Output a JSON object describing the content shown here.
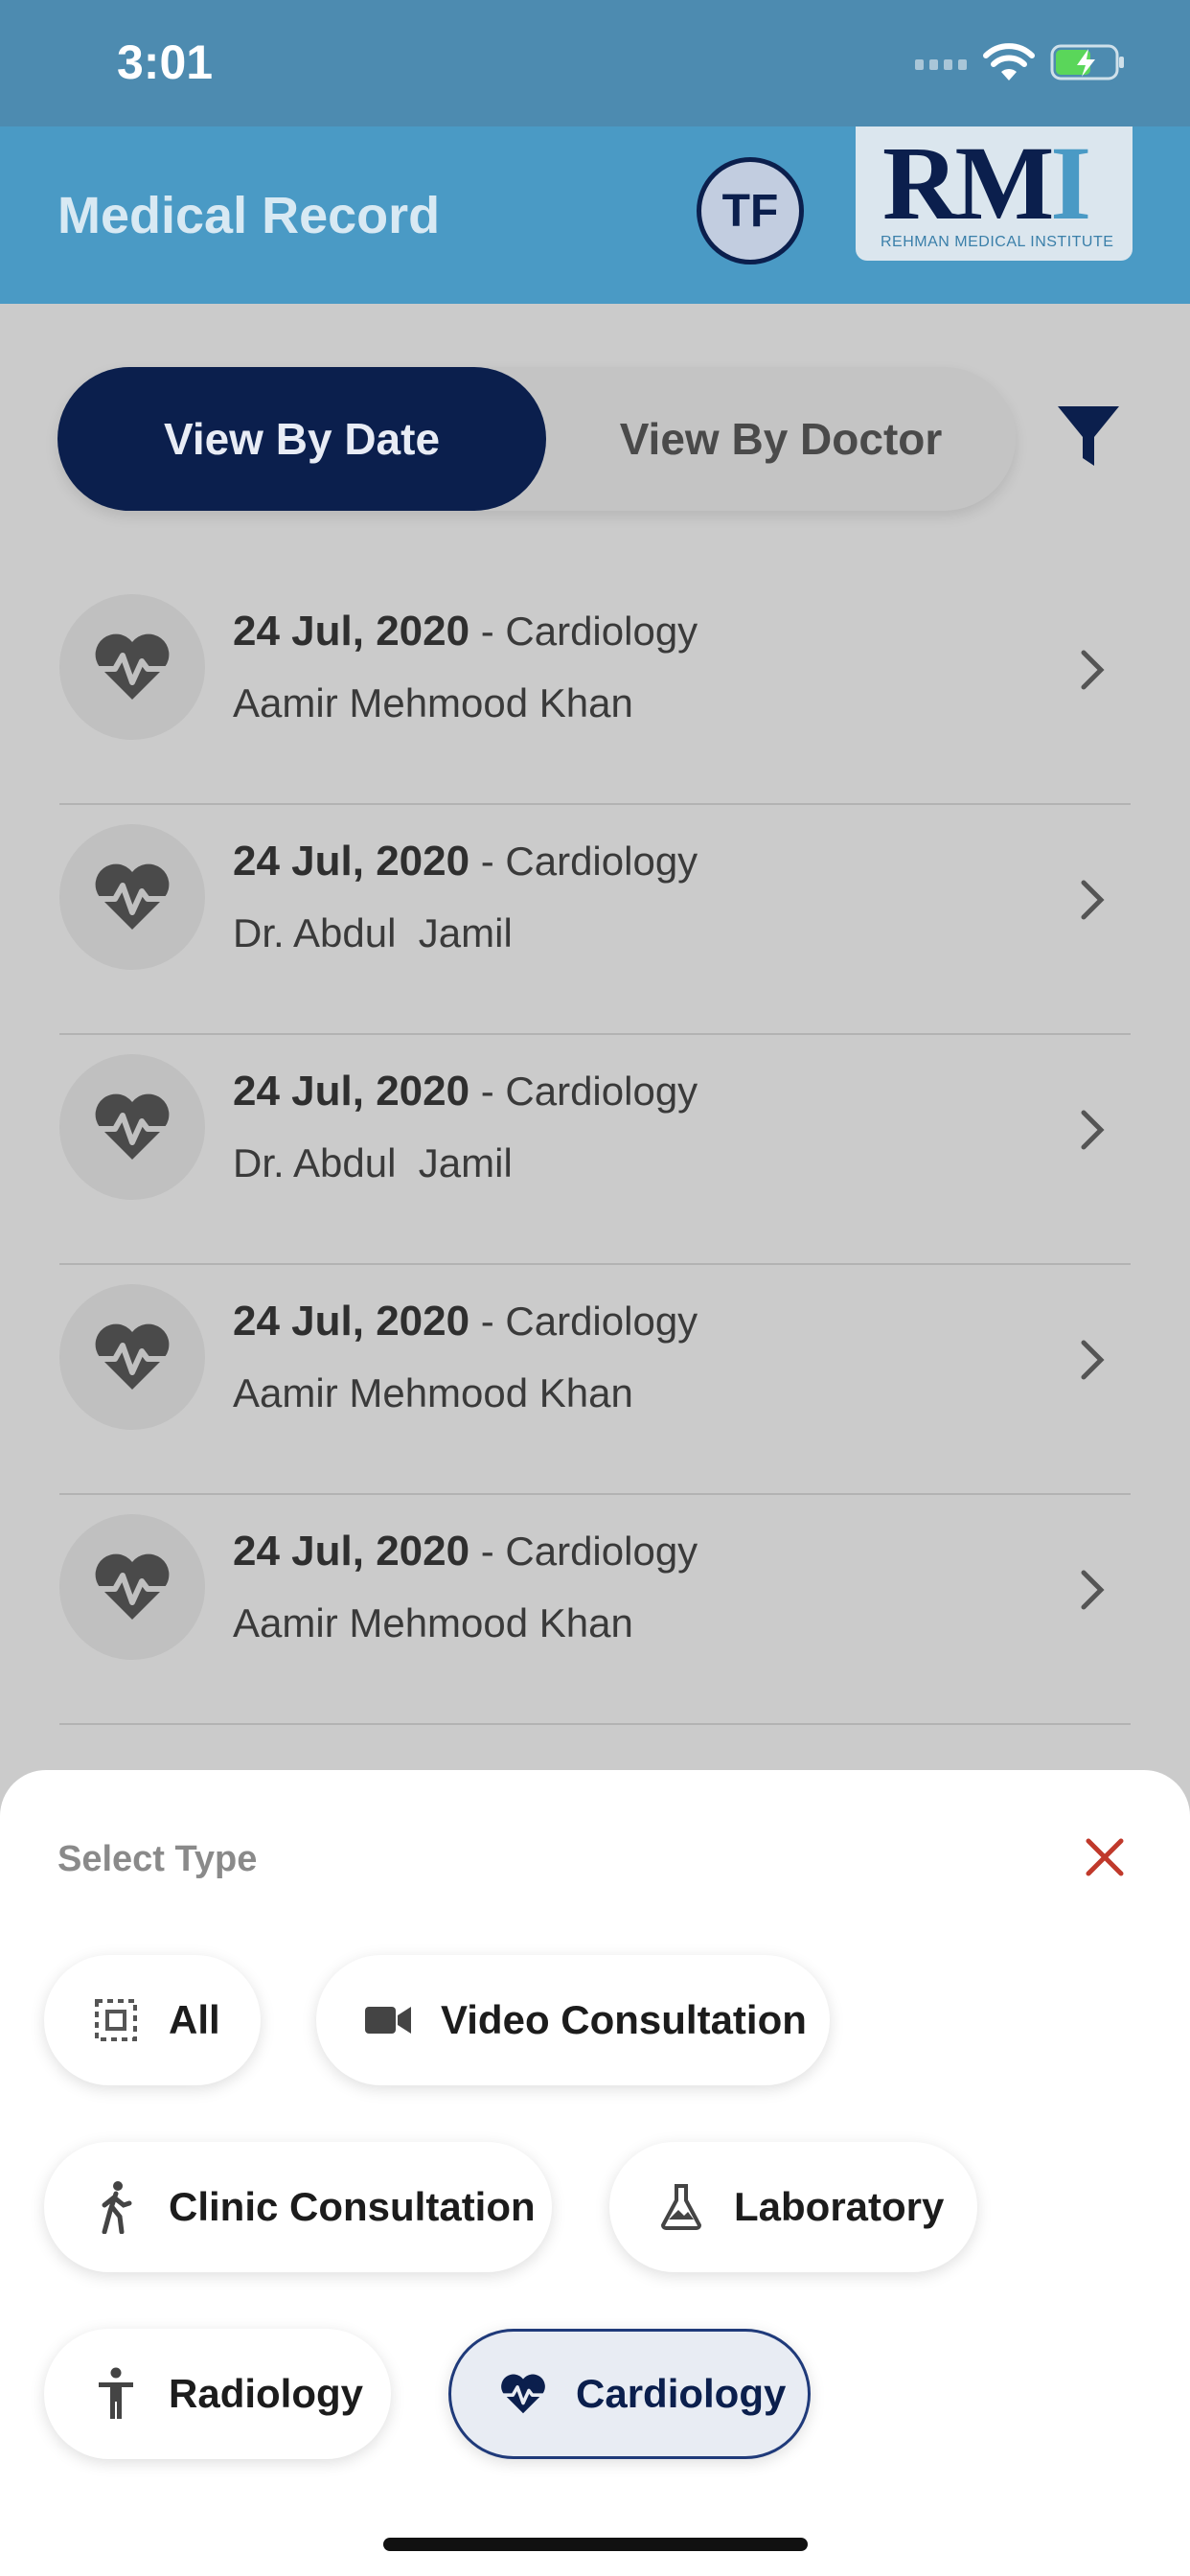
{
  "status_bar": {
    "time": "3:01"
  },
  "header": {
    "title": "Medical Record",
    "avatar_initials": "TF",
    "logo_text": "RMI",
    "logo_subtitle": "REHMAN MEDICAL INSTITUTE"
  },
  "view_toggle": {
    "by_date": "View By Date",
    "by_doctor": "View By Doctor",
    "active": "by_date"
  },
  "records": [
    {
      "date": "24 Jul, 2020",
      "dept": " - Cardiology",
      "doctor": "Aamir Mehmood Khan"
    },
    {
      "date": "24 Jul, 2020",
      "dept": " - Cardiology",
      "doctor": "Dr. Abdul  Jamil"
    },
    {
      "date": "24 Jul, 2020",
      "dept": " - Cardiology",
      "doctor": "Dr. Abdul  Jamil"
    },
    {
      "date": "24 Jul, 2020",
      "dept": " - Cardiology",
      "doctor": "Aamir Mehmood Khan"
    },
    {
      "date": "24 Jul, 2020",
      "dept": " - Cardiology",
      "doctor": "Aamir Mehmood Khan"
    }
  ],
  "sheet": {
    "label": "Select Type",
    "types": [
      {
        "label": "All",
        "icon": "select-all-icon",
        "selected": false
      },
      {
        "label": "Video Consultation",
        "icon": "video-camera-icon",
        "selected": false
      },
      {
        "label": "Clinic Consultation",
        "icon": "walking-person-icon",
        "selected": false
      },
      {
        "label": "Laboratory",
        "icon": "flask-icon",
        "selected": false
      },
      {
        "label": "Radiology",
        "icon": "person-standing-icon",
        "selected": false
      },
      {
        "label": "Cardiology",
        "icon": "heartbeat-icon",
        "selected": true
      }
    ]
  },
  "colors": {
    "navy": "#0b1f4d",
    "header_blue": "#4a9ac5",
    "status_blue": "#4d8bb0",
    "close_red": "#c0392b"
  }
}
